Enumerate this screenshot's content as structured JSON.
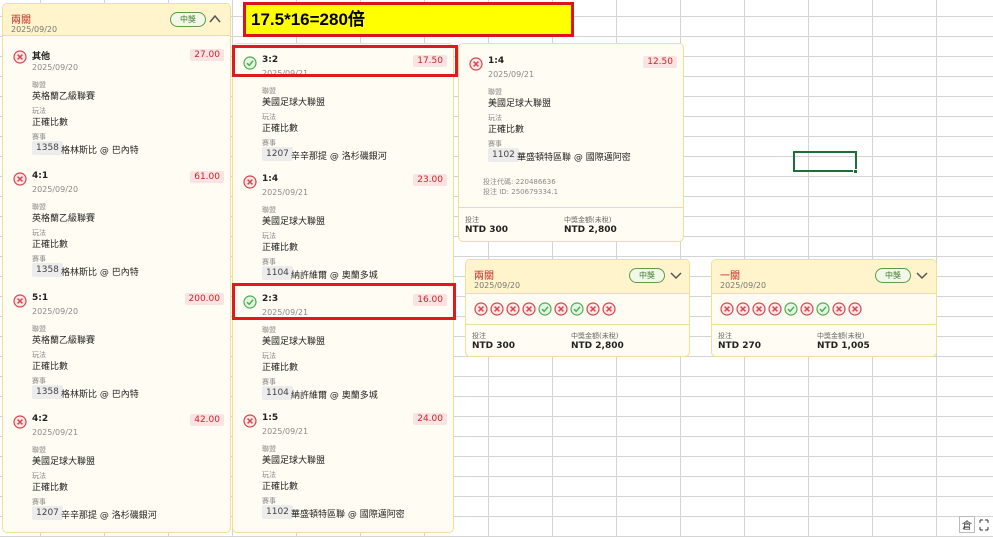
{
  "banner": {
    "text": "17.5*16=280倍"
  },
  "panel1": {
    "title": "兩關",
    "date": "2025/09/20",
    "badge": "中獎",
    "bets": [
      {
        "score": "其他",
        "date": "2025/09/20",
        "odds": "27.00",
        "status": "loss",
        "league_label": "聯盟",
        "league": "英格蘭乙級聯賽",
        "play_label": "玩法",
        "play": "正確比數",
        "match_label": "賽事",
        "match_id": "1358",
        "match": "格林斯比 @ 巴內特"
      },
      {
        "score": "4:1",
        "date": "2025/09/20",
        "odds": "61.00",
        "status": "loss",
        "league_label": "聯盟",
        "league": "英格蘭乙級聯賽",
        "play_label": "玩法",
        "play": "正確比數",
        "match_label": "賽事",
        "match_id": "1358",
        "match": "格林斯比 @ 巴內特"
      },
      {
        "score": "5:1",
        "date": "2025/09/20",
        "odds": "200.00",
        "status": "loss",
        "league_label": "聯盟",
        "league": "英格蘭乙級聯賽",
        "play_label": "玩法",
        "play": "正確比數",
        "match_label": "賽事",
        "match_id": "1358",
        "match": "格林斯比 @ 巴內特"
      },
      {
        "score": "4:2",
        "date": "2025/09/21",
        "odds": "42.00",
        "status": "loss",
        "league_label": "聯盟",
        "league": "美國足球大聯盟",
        "play_label": "玩法",
        "play": "正確比數",
        "match_label": "賽事",
        "match_id": "1207",
        "match": "辛辛那提 @ 洛杉磯銀河"
      }
    ]
  },
  "panel2": {
    "bets": [
      {
        "score": "3:2",
        "date": "2025/09/21",
        "odds": "17.50",
        "status": "win",
        "league_label": "聯盟",
        "league": "美國足球大聯盟",
        "play_label": "玩法",
        "play": "正確比數",
        "match_label": "賽事",
        "match_id": "1207",
        "match": "辛辛那提 @ 洛杉磯銀河"
      },
      {
        "score": "1:4",
        "date": "2025/09/21",
        "odds": "23.00",
        "status": "loss",
        "league_label": "聯盟",
        "league": "美國足球大聯盟",
        "play_label": "玩法",
        "play": "正確比數",
        "match_label": "賽事",
        "match_id": "1104",
        "match": "納許維爾 @ 奧蘭多城"
      },
      {
        "score": "2:3",
        "date": "2025/09/21",
        "odds": "16.00",
        "status": "win",
        "league_label": "聯盟",
        "league": "美國足球大聯盟",
        "play_label": "玩法",
        "play": "正確比數",
        "match_label": "賽事",
        "match_id": "1104",
        "match": "納許維爾 @ 奧蘭多城"
      },
      {
        "score": "1:5",
        "date": "2025/09/21",
        "odds": "24.00",
        "status": "loss",
        "league_label": "聯盟",
        "league": "美國足球大聯盟",
        "play_label": "玩法",
        "play": "正確比數",
        "match_label": "賽事",
        "match_id": "1102",
        "match": "華盛頓特區聯 @ 國際邁阿密"
      }
    ]
  },
  "panel3": {
    "bet": {
      "score": "1:4",
      "date": "2025/09/21",
      "odds": "12.50",
      "status": "loss",
      "league_label": "聯盟",
      "league": "美國足球大聯盟",
      "play_label": "玩法",
      "play": "正確比數",
      "match_label": "賽事",
      "match_id": "1102",
      "match": "華盛頓特區聯 @ 國際邁阿密"
    },
    "slip_no": "投注代碼: 220486636",
    "slip_id": "投注 ID: 250679334.1",
    "stake_label": "投注",
    "stake": "NTD 300",
    "payout_label": "中獎金額(未稅)",
    "payout": "NTD 2,800"
  },
  "panel4": {
    "title": "兩關",
    "date": "2025/09/20",
    "badge": "中獎",
    "results": [
      "loss",
      "loss",
      "loss",
      "loss",
      "win",
      "loss",
      "win",
      "loss",
      "loss"
    ],
    "stake_label": "投注",
    "stake": "NTD 300",
    "payout_label": "中獎金額(未稅)",
    "payout": "NTD 2,800"
  },
  "panel5": {
    "title": "一關",
    "date": "2025/09/20",
    "badge": "中獎",
    "results": [
      "loss",
      "loss",
      "loss",
      "loss",
      "win",
      "loss",
      "win",
      "loss",
      "loss"
    ],
    "stake_label": "投注",
    "stake": "NTD 270",
    "payout_label": "中獎金額(未稅)",
    "payout": "NTD 1,005"
  },
  "corner": {
    "ime": "倉"
  },
  "colors": {
    "loss": "#d9434a",
    "win": "#4caf50",
    "odds_bg": "#fbe3e3",
    "panel_bg": "#fffdf3",
    "header_bg": "#fff4cc",
    "highlight": "#e0191e",
    "banner": "#ffff00"
  }
}
